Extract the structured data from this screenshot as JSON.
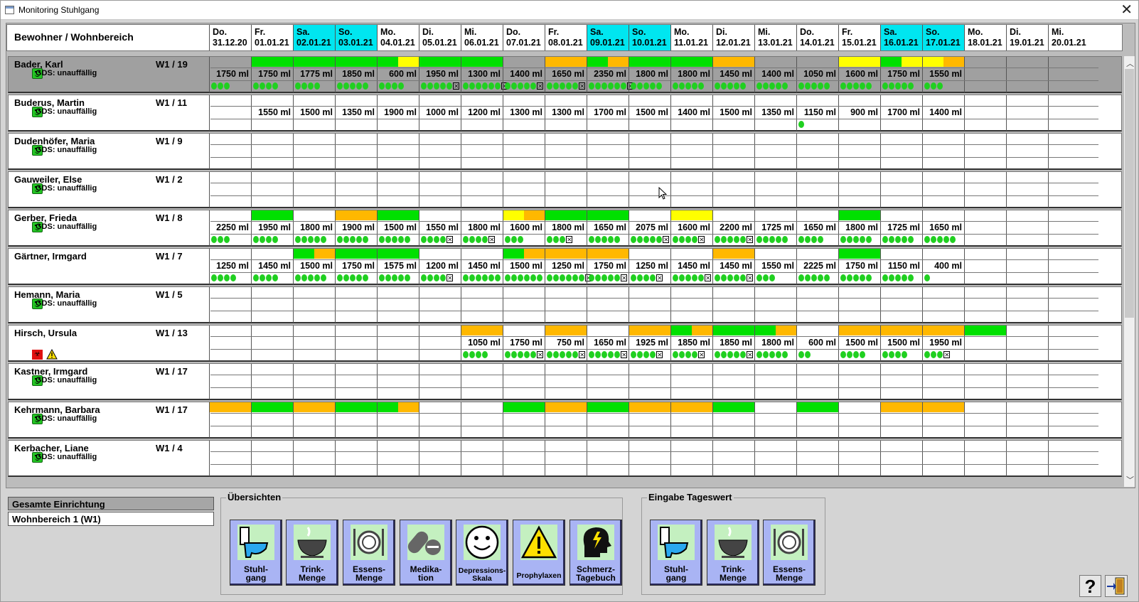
{
  "window": {
    "title": "Monitoring Stuhlgang",
    "close": "✕"
  },
  "header": {
    "resident_col": "Bewohner / Wohnbereich",
    "days": [
      {
        "wd": "Do.",
        "date": "31.12.20",
        "we": false
      },
      {
        "wd": "Fr.",
        "date": "01.01.21",
        "we": false
      },
      {
        "wd": "Sa.",
        "date": "02.01.21",
        "we": true
      },
      {
        "wd": "So.",
        "date": "03.01.21",
        "we": true
      },
      {
        "wd": "Mo.",
        "date": "04.01.21",
        "we": false
      },
      {
        "wd": "Di.",
        "date": "05.01.21",
        "we": false
      },
      {
        "wd": "Mi.",
        "date": "06.01.21",
        "we": false
      },
      {
        "wd": "Do.",
        "date": "07.01.21",
        "we": false
      },
      {
        "wd": "Fr.",
        "date": "08.01.21",
        "we": false
      },
      {
        "wd": "Sa.",
        "date": "09.01.21",
        "we": true
      },
      {
        "wd": "So.",
        "date": "10.01.21",
        "we": true
      },
      {
        "wd": "Mo.",
        "date": "11.01.21",
        "we": false
      },
      {
        "wd": "Di.",
        "date": "12.01.21",
        "we": false
      },
      {
        "wd": "Mi.",
        "date": "13.01.21",
        "we": false
      },
      {
        "wd": "Do.",
        "date": "14.01.21",
        "we": false
      },
      {
        "wd": "Fr.",
        "date": "15.01.21",
        "we": false
      },
      {
        "wd": "Sa.",
        "date": "16.01.21",
        "we": true
      },
      {
        "wd": "So.",
        "date": "17.01.21",
        "we": true
      },
      {
        "wd": "Mo.",
        "date": "18.01.21",
        "we": false
      },
      {
        "wd": "Di.",
        "date": "19.01.21",
        "we": false
      },
      {
        "wd": "Mi.",
        "date": "20.01.21",
        "we": false
      }
    ]
  },
  "colors": {
    "green": "#00e000",
    "orange": "#ffb800",
    "yellow": "#ffff00",
    "weekend": "#00e6f0",
    "button": "#a9b4f4"
  },
  "residents": [
    {
      "name": "Bader, Karl",
      "unit": "W1 / 19",
      "gds": "GDS: unauffällig",
      "selected": true,
      "icons": "smile",
      "bars": [
        "",
        "g",
        "g",
        "g",
        "gy",
        "g",
        "g",
        "",
        "o",
        "go",
        "g",
        "g",
        "o",
        "",
        "",
        "y",
        "gy",
        "yo",
        "",
        "",
        ""
      ],
      "ml": [
        "1750 ml",
        "1750 ml",
        "1775 ml",
        "1850 ml",
        "600 ml",
        "1950 ml",
        "1300 ml",
        "1400 ml",
        "1650 ml",
        "2350 ml",
        "1800 ml",
        "1800 ml",
        "1450 ml",
        "1400 ml",
        "1050 ml",
        "1600 ml",
        "1750 ml",
        "1550 ml",
        "",
        "",
        ""
      ],
      "dots": [
        3,
        4,
        4,
        5,
        4,
        5,
        6,
        5,
        5,
        6,
        5,
        5,
        5,
        5,
        5,
        5,
        5,
        3,
        0,
        0,
        0
      ],
      "x": [
        0,
        0,
        0,
        0,
        0,
        1,
        1,
        1,
        1,
        1,
        0,
        0,
        0,
        0,
        0,
        0,
        0,
        0,
        0,
        0,
        0
      ]
    },
    {
      "name": "Buderus, Martin",
      "unit": "W1 / 11",
      "gds": "GDS: unauffällig",
      "icons": "smile",
      "bars": [
        "",
        "",
        "",
        "",
        "",
        "",
        "",
        "",
        "",
        "",
        "",
        "",
        "",
        "",
        "",
        "",
        "",
        "",
        "",
        "",
        ""
      ],
      "ml": [
        "",
        "1550 ml",
        "1500 ml",
        "1350 ml",
        "1900 ml",
        "1000 ml",
        "1200 ml",
        "1300 ml",
        "1300 ml",
        "1700 ml",
        "1500 ml",
        "1400 ml",
        "1500 ml",
        "1350 ml",
        "1150 ml",
        "900 ml",
        "1700 ml",
        "1400 ml",
        "",
        "",
        ""
      ],
      "dots": [
        0,
        0,
        0,
        0,
        0,
        0,
        0,
        0,
        0,
        0,
        0,
        0,
        0,
        0,
        1,
        0,
        0,
        0,
        0,
        0,
        0
      ],
      "x": [
        0,
        0,
        0,
        0,
        0,
        0,
        0,
        0,
        0,
        0,
        0,
        0,
        0,
        0,
        0,
        0,
        0,
        0,
        0,
        0,
        0
      ]
    },
    {
      "name": "Dudenhöfer, Maria",
      "unit": "W1 / 9",
      "gds": "GDS: unauffällig",
      "icons": "smile",
      "bars": [],
      "ml": [],
      "dots": [],
      "x": []
    },
    {
      "name": "Gauweiler, Else",
      "unit": "W1 / 2",
      "gds": "GDS: unauffällig",
      "icons": "smile",
      "bars": [],
      "ml": [],
      "dots": [],
      "x": []
    },
    {
      "name": "Gerber, Frieda",
      "unit": "W1 / 8",
      "gds": "GDS: unauffällig",
      "icons": "smile",
      "bars": [
        "",
        "g",
        "",
        "o",
        "g",
        "",
        "",
        "yo",
        "g",
        "g",
        "",
        "y",
        "",
        "",
        "",
        "g",
        "",
        "",
        "",
        "",
        ""
      ],
      "ml": [
        "2250 ml",
        "1950 ml",
        "1800 ml",
        "1900 ml",
        "1500 ml",
        "1550 ml",
        "1800 ml",
        "1600 ml",
        "1800 ml",
        "1650 ml",
        "2075 ml",
        "1600 ml",
        "2200 ml",
        "1725 ml",
        "1650 ml",
        "1800 ml",
        "1725 ml",
        "1650 ml",
        "",
        "",
        ""
      ],
      "dots": [
        3,
        4,
        5,
        5,
        5,
        4,
        4,
        3,
        3,
        5,
        5,
        4,
        5,
        5,
        4,
        5,
        5,
        5,
        0,
        0,
        0
      ],
      "x": [
        0,
        0,
        0,
        0,
        0,
        1,
        1,
        0,
        1,
        0,
        1,
        1,
        1,
        0,
        0,
        0,
        0,
        0,
        0,
        0,
        0
      ]
    },
    {
      "name": "Gärtner, Irmgard",
      "unit": "W1 / 7",
      "gds": "",
      "icons": "",
      "bars": [
        "",
        "",
        "go",
        "g",
        "g",
        "",
        "",
        "go",
        "o",
        "o",
        "",
        "",
        "o",
        "",
        "",
        "g",
        "",
        "",
        "",
        "",
        ""
      ],
      "ml": [
        "1250 ml",
        "1450 ml",
        "1500 ml",
        "1750 ml",
        "1575 ml",
        "1200 ml",
        "1450 ml",
        "1500 ml",
        "1250 ml",
        "1750 ml",
        "1250 ml",
        "1450 ml",
        "1450 ml",
        "1550 ml",
        "2225 ml",
        "1750 ml",
        "1150 ml",
        "400 ml",
        "",
        "",
        ""
      ],
      "dots": [
        4,
        4,
        5,
        5,
        5,
        4,
        6,
        6,
        6,
        5,
        4,
        5,
        5,
        3,
        5,
        5,
        5,
        1,
        0,
        0,
        0
      ],
      "x": [
        0,
        0,
        0,
        0,
        0,
        1,
        0,
        0,
        1,
        1,
        1,
        1,
        1,
        0,
        0,
        0,
        0,
        0,
        0,
        0,
        0
      ]
    },
    {
      "name": "Hemann, Maria",
      "unit": "W1 / 5",
      "gds": "GDS: unauffällig",
      "icons": "smile",
      "bars": [],
      "ml": [],
      "dots": [],
      "x": []
    },
    {
      "name": "Hirsch, Ursula",
      "unit": "W1 / 13",
      "gds": "",
      "icons": "warn",
      "bars": [
        "",
        "",
        "",
        "",
        "",
        "",
        "o",
        "",
        "o",
        "",
        "o",
        "go",
        "g",
        "go",
        "",
        "o",
        "o",
        "o",
        "g",
        "",
        ""
      ],
      "ml": [
        "",
        "",
        "",
        "",
        "",
        "",
        "1050 ml",
        "1750 ml",
        "750 ml",
        "1650 ml",
        "1925 ml",
        "1850 ml",
        "1850 ml",
        "1800 ml",
        "600 ml",
        "1500 ml",
        "1500 ml",
        "1950 ml",
        "",
        "",
        ""
      ],
      "dots": [
        0,
        0,
        0,
        0,
        0,
        0,
        4,
        5,
        5,
        5,
        4,
        4,
        5,
        5,
        2,
        4,
        4,
        3,
        0,
        0,
        0
      ],
      "x": [
        0,
        0,
        0,
        0,
        0,
        0,
        0,
        1,
        1,
        1,
        1,
        1,
        1,
        0,
        0,
        0,
        0,
        1,
        0,
        0,
        0
      ]
    },
    {
      "name": "Kastner, Irmgard",
      "unit": "W1 / 17",
      "gds": "GDS: unauffällig",
      "icons": "smile",
      "bars": [],
      "ml": [],
      "dots": [],
      "x": []
    },
    {
      "name": "Kehrmann, Barbara",
      "unit": "W1 / 17",
      "gds": "GDS: unauffällig",
      "icons": "smile",
      "bars": [
        "o",
        "g",
        "o",
        "g",
        "go",
        "",
        "",
        "g",
        "o",
        "g",
        "o",
        "o",
        "g",
        "",
        "g",
        "",
        "o",
        "o",
        "",
        "",
        ""
      ],
      "ml": [],
      "dots": [],
      "x": []
    },
    {
      "name": "Kerbacher, Liane",
      "unit": "W1 / 4",
      "gds": "GDS: unauffällig",
      "icons": "smile",
      "bars": [],
      "ml": [],
      "dots": [],
      "x": []
    }
  ],
  "left_panel": {
    "all": "Gesamte Einrichtung",
    "w1": "Wohnbereich 1 (W1)"
  },
  "overviews": {
    "title": "Übersichten",
    "buttons": [
      {
        "l1": "Stuhl-",
        "l2": "gang",
        "icon": "toilet-icon"
      },
      {
        "l1": "Trink-",
        "l2": "Menge",
        "icon": "cup-icon"
      },
      {
        "l1": "Essens-",
        "l2": "Menge",
        "icon": "plate-icon"
      },
      {
        "l1": "Medika-",
        "l2": "tion",
        "icon": "pill-icon"
      },
      {
        "l1": "Depressions-",
        "l2": "Skala",
        "icon": "smiley-icon"
      },
      {
        "l1": "Prophylaxen",
        "l2": "",
        "icon": "warning-icon"
      },
      {
        "l1": "Schmerz-",
        "l2": "Tagebuch",
        "icon": "head-pain-icon"
      }
    ]
  },
  "input": {
    "title": "Eingabe Tageswert",
    "buttons": [
      {
        "l1": "Stuhl-",
        "l2": "gang",
        "icon": "toilet-icon"
      },
      {
        "l1": "Trink-",
        "l2": "Menge",
        "icon": "cup-icon"
      },
      {
        "l1": "Essens-",
        "l2": "Menge",
        "icon": "plate-icon"
      }
    ]
  },
  "help": "?"
}
